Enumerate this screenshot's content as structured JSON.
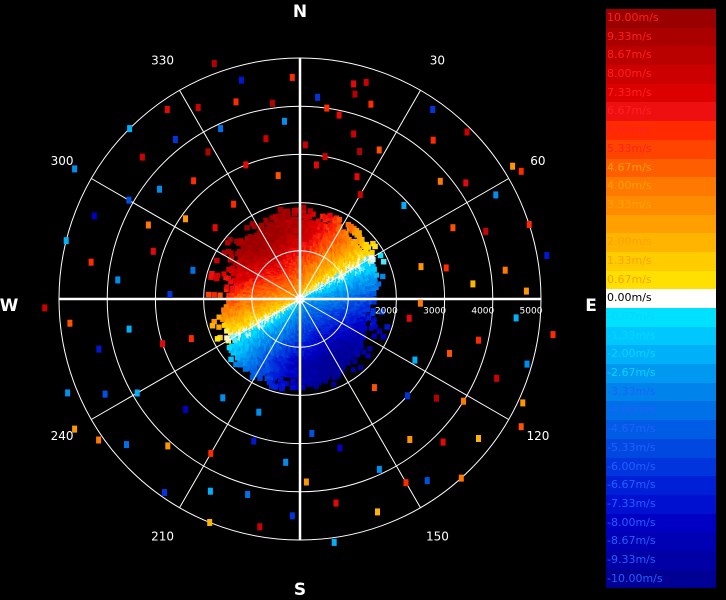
{
  "chart_data": {
    "type": "polar-scatter",
    "compass": {
      "N": "N",
      "E": "E",
      "S": "S",
      "W": "W"
    },
    "angle_ticks": [
      "30",
      "60",
      "120",
      "150",
      "210",
      "240",
      "300",
      "330"
    ],
    "angle_tick_degrees": [
      30,
      60,
      120,
      150,
      210,
      240,
      300,
      330
    ],
    "range_ticks": [
      "2000",
      "3000",
      "4000",
      "5000"
    ],
    "range_tick_values": [
      2000,
      3000,
      4000,
      5000
    ],
    "range_max": 5000,
    "range_ring_values": [
      1000,
      2000,
      3000,
      4000,
      5000
    ],
    "spoke_degrees": [
      0,
      30,
      60,
      90,
      120,
      150,
      180,
      210,
      240,
      270,
      300,
      330
    ],
    "grid": true,
    "colorbar": {
      "labels": [
        "10.00m/s",
        "9.33m/s",
        "8.67m/s",
        "8.00m/s",
        "7.33m/s",
        "6.67m/s",
        "6.00m/s",
        "5.33m/s",
        "4.67m/s",
        "4.00m/s",
        "3.33m/s",
        "2.67m/s",
        "2.00m/s",
        "1.33m/s",
        "0.67m/s",
        "0.00m/s",
        "-0.67m/s",
        "-1.33m/s",
        "-2.00m/s",
        "-2.67m/s",
        "-3.33m/s",
        "-4.00m/s",
        "-4.67m/s",
        "-5.33m/s",
        "-6.00m/s",
        "-6.67m/s",
        "-7.33m/s",
        "-8.00m/s",
        "-8.67m/s",
        "-9.33m/s",
        "-10.00m/s"
      ],
      "values": [
        10,
        9.33,
        8.67,
        8,
        7.33,
        6.67,
        6,
        5.33,
        4.67,
        4,
        3.33,
        2.67,
        2,
        1.33,
        0.67,
        0,
        -0.67,
        -1.33,
        -2,
        -2.67,
        -3.33,
        -4,
        -4.67,
        -5.33,
        -6,
        -6.67,
        -7.33,
        -8,
        -8.67,
        -9.33,
        -10
      ],
      "colors": [
        "#9a0000",
        "#aa0000",
        "#bb0000",
        "#cc0000",
        "#dd0000",
        "#ee1010",
        "#ff2a00",
        "#ff4400",
        "#ff5e00",
        "#ff7800",
        "#ff8c00",
        "#ffa000",
        "#ffb400",
        "#ffcc00",
        "#ffe000",
        "#ffffff",
        "#00e0ff",
        "#00c8ff",
        "#00b0f8",
        "#0098f0",
        "#0084ec",
        "#0070e8",
        "#005ce4",
        "#0048e0",
        "#0034dc",
        "#0020d8",
        "#0010d0",
        "#0000c4",
        "#0000b4",
        "#0000a4",
        "#000094"
      ]
    },
    "inner_field": {
      "description_free": true,
      "max_range": 1900,
      "speed_min": -10,
      "speed_max": 10
    },
    "sparse_returns": [
      {
        "az": 15,
        "r": 4400,
        "v": 9
      },
      {
        "az": 17,
        "r": 4700,
        "v": 8
      },
      {
        "az": 14,
        "r": 4600,
        "v": 7
      },
      {
        "az": 20,
        "r": 4300,
        "v": 6
      },
      {
        "az": 18,
        "r": 3600,
        "v": 8
      },
      {
        "az": 22,
        "r": 3300,
        "v": 9
      },
      {
        "az": 12,
        "r": 3900,
        "v": 7
      },
      {
        "az": 8,
        "r": 4000,
        "v": 6
      },
      {
        "az": 25,
        "r": 2800,
        "v": 7
      },
      {
        "az": 28,
        "r": 3500,
        "v": 5
      },
      {
        "az": 10,
        "r": 3000,
        "v": 8
      },
      {
        "az": 35,
        "r": 4800,
        "v": -6
      },
      {
        "az": 40,
        "r": 4300,
        "v": 6
      },
      {
        "az": 45,
        "r": 4900,
        "v": 8
      },
      {
        "az": 50,
        "r": 3800,
        "v": 4
      },
      {
        "az": 55,
        "r": 4200,
        "v": 7
      },
      {
        "az": 58,
        "r": 5200,
        "v": 3
      },
      {
        "az": 62,
        "r": 4600,
        "v": -3
      },
      {
        "az": 65,
        "r": 3500,
        "v": 5
      },
      {
        "az": 70,
        "r": 4100,
        "v": 8
      },
      {
        "az": 72,
        "r": 5000,
        "v": 6
      },
      {
        "az": 75,
        "r": 2600,
        "v": 3
      },
      {
        "az": 78,
        "r": 3100,
        "v": 6
      },
      {
        "az": 80,
        "r": 5200,
        "v": -7
      },
      {
        "az": 82,
        "r": 4300,
        "v": 4
      },
      {
        "az": 85,
        "r": 3600,
        "v": 2
      },
      {
        "az": 88,
        "r": 4700,
        "v": 3
      },
      {
        "az": 95,
        "r": 4500,
        "v": -2
      },
      {
        "az": 98,
        "r": 5300,
        "v": 6
      },
      {
        "az": 100,
        "r": 2300,
        "v": 7
      },
      {
        "az": 103,
        "r": 3800,
        "v": 6
      },
      {
        "az": 106,
        "r": 4900,
        "v": -3
      },
      {
        "az": 110,
        "r": 3300,
        "v": 5
      },
      {
        "az": 112,
        "r": 4400,
        "v": 8
      },
      {
        "az": 115,
        "r": 5100,
        "v": 3
      },
      {
        "az": 118,
        "r": 2700,
        "v": -2
      },
      {
        "az": 122,
        "r": 4000,
        "v": 4
      },
      {
        "az": 126,
        "r": 3500,
        "v": 9
      },
      {
        "az": 128,
        "r": 4700,
        "v": 2
      },
      {
        "az": 132,
        "r": 3000,
        "v": -6
      },
      {
        "az": 135,
        "r": 4200,
        "v": 7
      },
      {
        "az": 138,
        "r": 5000,
        "v": 4
      },
      {
        "az": 142,
        "r": 3700,
        "v": 3
      },
      {
        "az": 145,
        "r": 4600,
        "v": -5
      },
      {
        "az": 150,
        "r": 4400,
        "v": 6
      },
      {
        "az": 155,
        "r": 3900,
        "v": -3
      },
      {
        "az": 160,
        "r": 4700,
        "v": 2
      },
      {
        "az": 165,
        "r": 3200,
        "v": -8
      },
      {
        "az": 170,
        "r": 4300,
        "v": 7
      },
      {
        "az": 172,
        "r": 5100,
        "v": -2
      },
      {
        "az": 175,
        "r": 2800,
        "v": -5
      },
      {
        "az": 178,
        "r": 3800,
        "v": 3
      },
      {
        "az": 182,
        "r": 4500,
        "v": -6
      },
      {
        "az": 185,
        "r": 3400,
        "v": -3
      },
      {
        "az": 190,
        "r": 4800,
        "v": 8
      },
      {
        "az": 195,
        "r": 4200,
        "v": -4
      },
      {
        "az": 198,
        "r": 3100,
        "v": -7
      },
      {
        "az": 202,
        "r": 5000,
        "v": 2
      },
      {
        "az": 205,
        "r": 4400,
        "v": -2
      },
      {
        "az": 210,
        "r": 3700,
        "v": 6
      },
      {
        "az": 215,
        "r": 4900,
        "v": -6
      },
      {
        "az": 218,
        "r": 2600,
        "v": -3
      },
      {
        "az": 222,
        "r": 4100,
        "v": 3
      },
      {
        "az": 226,
        "r": 3300,
        "v": -8
      },
      {
        "az": 230,
        "r": 4700,
        "v": -4
      },
      {
        "az": 235,
        "r": 5100,
        "v": 4
      },
      {
        "az": 240,
        "r": 3900,
        "v": -2
      },
      {
        "az": 244,
        "r": 4500,
        "v": -5
      },
      {
        "az": 248,
        "r": 5200,
        "v": -3
      },
      {
        "az": 252,
        "r": 3000,
        "v": 7
      },
      {
        "az": 256,
        "r": 4300,
        "v": -7
      },
      {
        "az": 260,
        "r": 3600,
        "v": -2
      },
      {
        "az": 264,
        "r": 4800,
        "v": 5
      },
      {
        "az": 268,
        "r": 5300,
        "v": 8
      },
      {
        "az": 272,
        "r": 2700,
        "v": -6
      },
      {
        "az": 276,
        "r": 3800,
        "v": -3
      },
      {
        "az": 280,
        "r": 4400,
        "v": 6
      },
      {
        "az": 284,
        "r": 5000,
        "v": -2
      },
      {
        "az": 288,
        "r": 3200,
        "v": 7
      },
      {
        "az": 292,
        "r": 4600,
        "v": -8
      },
      {
        "az": 296,
        "r": 3500,
        "v": 4
      },
      {
        "az": 300,
        "r": 4100,
        "v": -5
      },
      {
        "az": 305,
        "r": 2900,
        "v": 3
      },
      {
        "az": 308,
        "r": 3700,
        "v": -3
      },
      {
        "az": 312,
        "r": 4400,
        "v": 8
      },
      {
        "az": 315,
        "r": 5000,
        "v": -2
      },
      {
        "az": 318,
        "r": 3300,
        "v": 6
      },
      {
        "az": 322,
        "r": 4200,
        "v": -6
      },
      {
        "az": 325,
        "r": 4800,
        "v": 7
      },
      {
        "az": 328,
        "r": 3600,
        "v": 9
      },
      {
        "az": 332,
        "r": 4500,
        "v": 8
      },
      {
        "az": 335,
        "r": 3900,
        "v": -4
      },
      {
        "az": 338,
        "r": 3000,
        "v": 7
      },
      {
        "az": 342,
        "r": 4300,
        "v": 6
      },
      {
        "az": 345,
        "r": 4700,
        "v": -7
      },
      {
        "az": 348,
        "r": 3400,
        "v": 8
      },
      {
        "az": 350,
        "r": 2600,
        "v": 5
      },
      {
        "az": 352,
        "r": 4100,
        "v": 9
      },
      {
        "az": 355,
        "r": 3700,
        "v": -3
      },
      {
        "az": 358,
        "r": 4600,
        "v": 6
      },
      {
        "az": 2,
        "r": 3200,
        "v": 8
      },
      {
        "az": 5,
        "r": 4200,
        "v": -6
      },
      {
        "az": 7,
        "r": 2800,
        "v": 7
      },
      {
        "az": 340,
        "r": 5200,
        "v": 9
      },
      {
        "az": 325,
        "r": 2400,
        "v": 6
      },
      {
        "az": 30,
        "r": 2500,
        "v": 8
      },
      {
        "az": 48,
        "r": 2900,
        "v": -2
      },
      {
        "az": 92,
        "r": 2500,
        "v": 4
      },
      {
        "az": 140,
        "r": 2400,
        "v": 5
      },
      {
        "az": 200,
        "r": 2500,
        "v": -3
      },
      {
        "az": 250,
        "r": 2400,
        "v": 6
      },
      {
        "az": 285,
        "r": 2300,
        "v": -4
      },
      {
        "az": 310,
        "r": 2300,
        "v": 7
      },
      {
        "az": 120,
        "r": 5300,
        "v": 5
      },
      {
        "az": 240,
        "r": 5400,
        "v": 3
      },
      {
        "az": 60,
        "r": 5300,
        "v": 6
      },
      {
        "az": 300,
        "r": 5400,
        "v": -3
      }
    ]
  }
}
